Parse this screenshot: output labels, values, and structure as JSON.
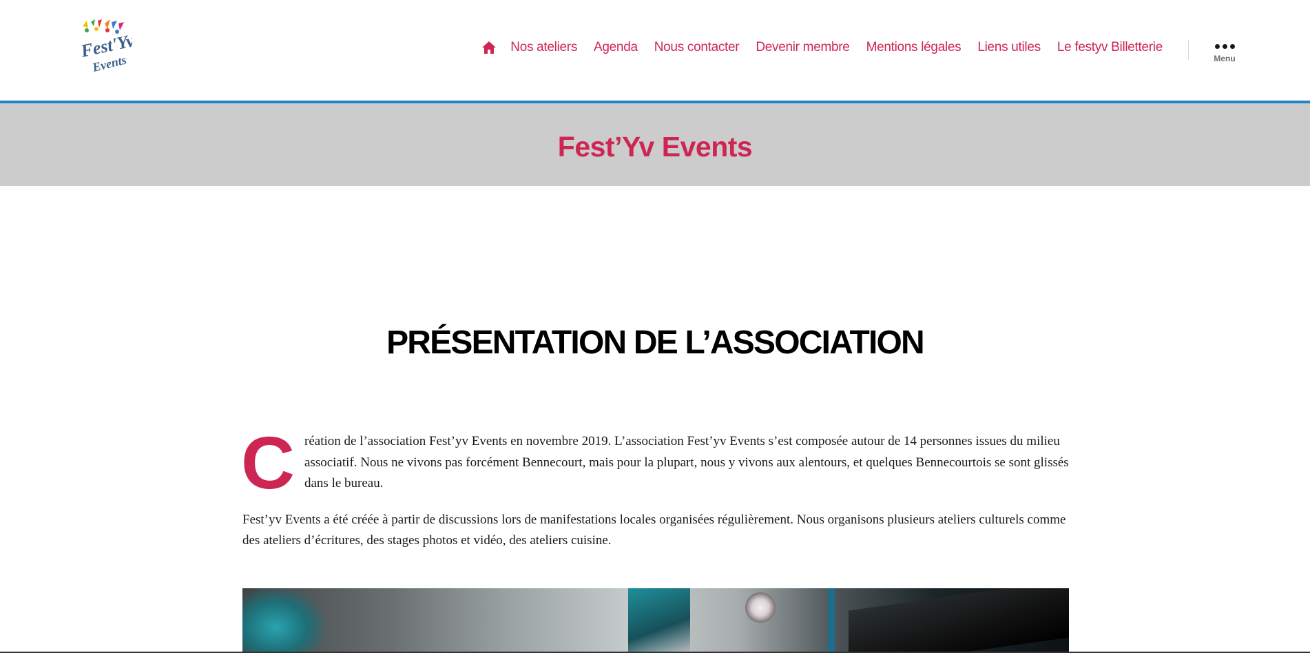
{
  "header": {
    "logo_alt": "Fest'Yv Events",
    "nav": [
      {
        "label": "Nos ateliers"
      },
      {
        "label": "Agenda"
      },
      {
        "label": "Nous contacter"
      },
      {
        "label": "Devenir membre"
      },
      {
        "label": "Mentions légales"
      },
      {
        "label": "Liens utiles"
      },
      {
        "label": "Le festyv Billetterie"
      }
    ],
    "menu_label": "Menu"
  },
  "site_title": "Fest’Yv Events",
  "page": {
    "heading": "PRÉSENTATION DE L’ASSOCIATION",
    "dropcap": "C",
    "paragraph1": "réation de l’association Fest’yv Events en novembre 2019. L’association Fest’yv Events s’est composée autour de 14 personnes issues du milieu associatif. Nous ne vivons pas forcément Bennecourt, mais pour la plupart, nous y vivons aux alentours, et quelques Bennecourtois se sont glissés dans le bureau.",
    "paragraph2": "Fest’yv Events a été créée à partir de discussions lors de manifestations locales organisées régulièrement. Nous organisons plusieurs ateliers culturels comme des ateliers d’écritures, des stages photos et vidéo, des ateliers cuisine."
  },
  "colors": {
    "accent": "#cd2653",
    "header_border": "#1e84c6",
    "title_band": "#cccccc"
  },
  "icons": {
    "home": "home-icon",
    "menu": "ellipsis-icon"
  }
}
